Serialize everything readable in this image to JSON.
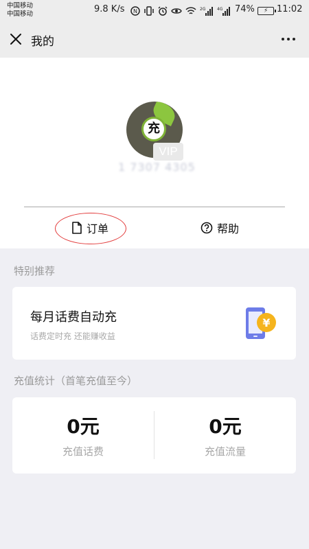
{
  "status_bar": {
    "carrier_1": "中国移动",
    "carrier_2": "中国移动",
    "net_speed": "9.8 K/s",
    "network_1": "2G",
    "network_2": "4G",
    "battery": "74%",
    "time": "11:02"
  },
  "nav": {
    "title": "我的"
  },
  "profile": {
    "avatar_char": "充",
    "vip_label": "VIP",
    "phone": "1 7307 4305"
  },
  "tabs": {
    "orders": "订单",
    "help": "帮助"
  },
  "recommend": {
    "section_title": "特别推荐",
    "card_title": "每月话费自动充",
    "card_subtitle": "话费定时充 还能赚收益",
    "icon": "phone-yen-icon"
  },
  "stats": {
    "section_title": "充值统计（首笔充值至今）",
    "items": [
      {
        "value": "0元",
        "label": "充值话费"
      },
      {
        "value": "0元",
        "label": "充值流量"
      }
    ]
  },
  "colors": {
    "accent_yellow": "#f5b41d",
    "phone_blue": "#6d7ce8",
    "annotation_red": "#e23b3b",
    "avatar_green": "#8cc63f"
  }
}
